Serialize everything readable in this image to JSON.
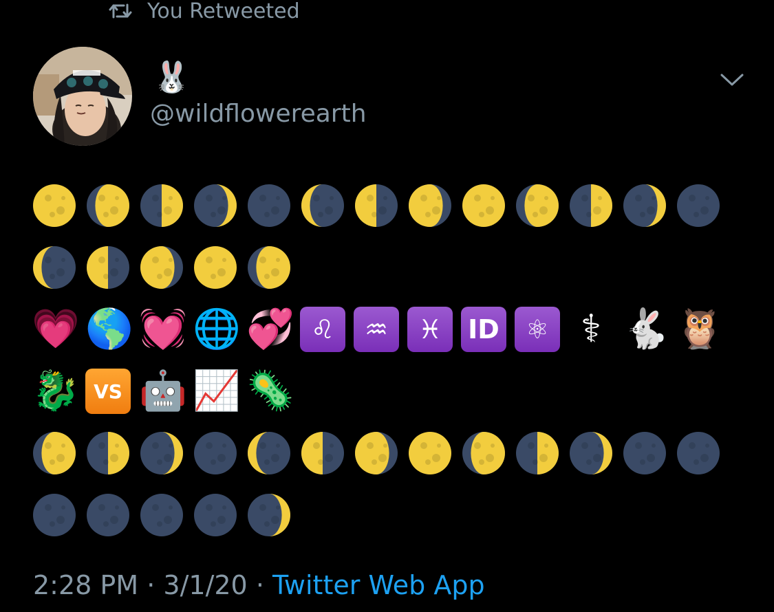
{
  "retweet": {
    "label": "You Retweeted",
    "icon": "retweet-icon"
  },
  "tweet": {
    "author": {
      "display_name": "🐰",
      "handle": "@wildflowerearth",
      "avatar": "avatar"
    },
    "rows": [
      [
        "full",
        "wax-gib",
        "first-q",
        "wax-cres",
        "new",
        "wane-cres",
        "last-q",
        "wane-gib",
        "full",
        "wax-gib",
        "first-q",
        "wax-cres",
        "new"
      ],
      [
        "wane-cres",
        "last-q",
        "wane-gib",
        "full",
        "wax-gib"
      ],
      [
        "growing-heart",
        "earth-americas",
        "beating-heart",
        "globe-meridians",
        "two-hearts",
        "leo",
        "aquarius",
        "pisces",
        "id-button",
        "atom",
        "medical",
        "rabbit",
        "owl"
      ],
      [
        "dragon",
        "vs-button",
        "robot",
        "chart-up",
        "microbe"
      ],
      [
        "wax-gib",
        "first-q",
        "wax-cres",
        "new",
        "wane-cres",
        "last-q",
        "wane-gib",
        "full",
        "wax-gib",
        "first-q",
        "wax-cres",
        "new",
        "new"
      ],
      [
        "new",
        "new",
        "new",
        "new",
        "wax-cres"
      ]
    ],
    "glyphs": {
      "growing-heart": "💗",
      "earth-americas": "🌎",
      "beating-heart": "💓",
      "globe-meridians": "🌐",
      "two-hearts": "💞",
      "leo": "♌",
      "aquarius": "♒",
      "pisces": "♓",
      "id-button": "ID",
      "atom": "⚛",
      "medical": "⚕",
      "rabbit": "🐇",
      "owl": "🦉",
      "dragon": "🐉",
      "vs-button": "VS",
      "robot": "🤖",
      "chart-up": "📈",
      "microbe": "🦠"
    },
    "timestamp": "2:28 PM",
    "date": "3/1/20",
    "separator": "·",
    "source": "Twitter Web App"
  },
  "colors": {
    "background": "#000000",
    "secondary_text": "#8899a6",
    "link": "#1da1f2",
    "moon_lit": "#f2cd3e",
    "moon_dark": "#3a4a66"
  }
}
